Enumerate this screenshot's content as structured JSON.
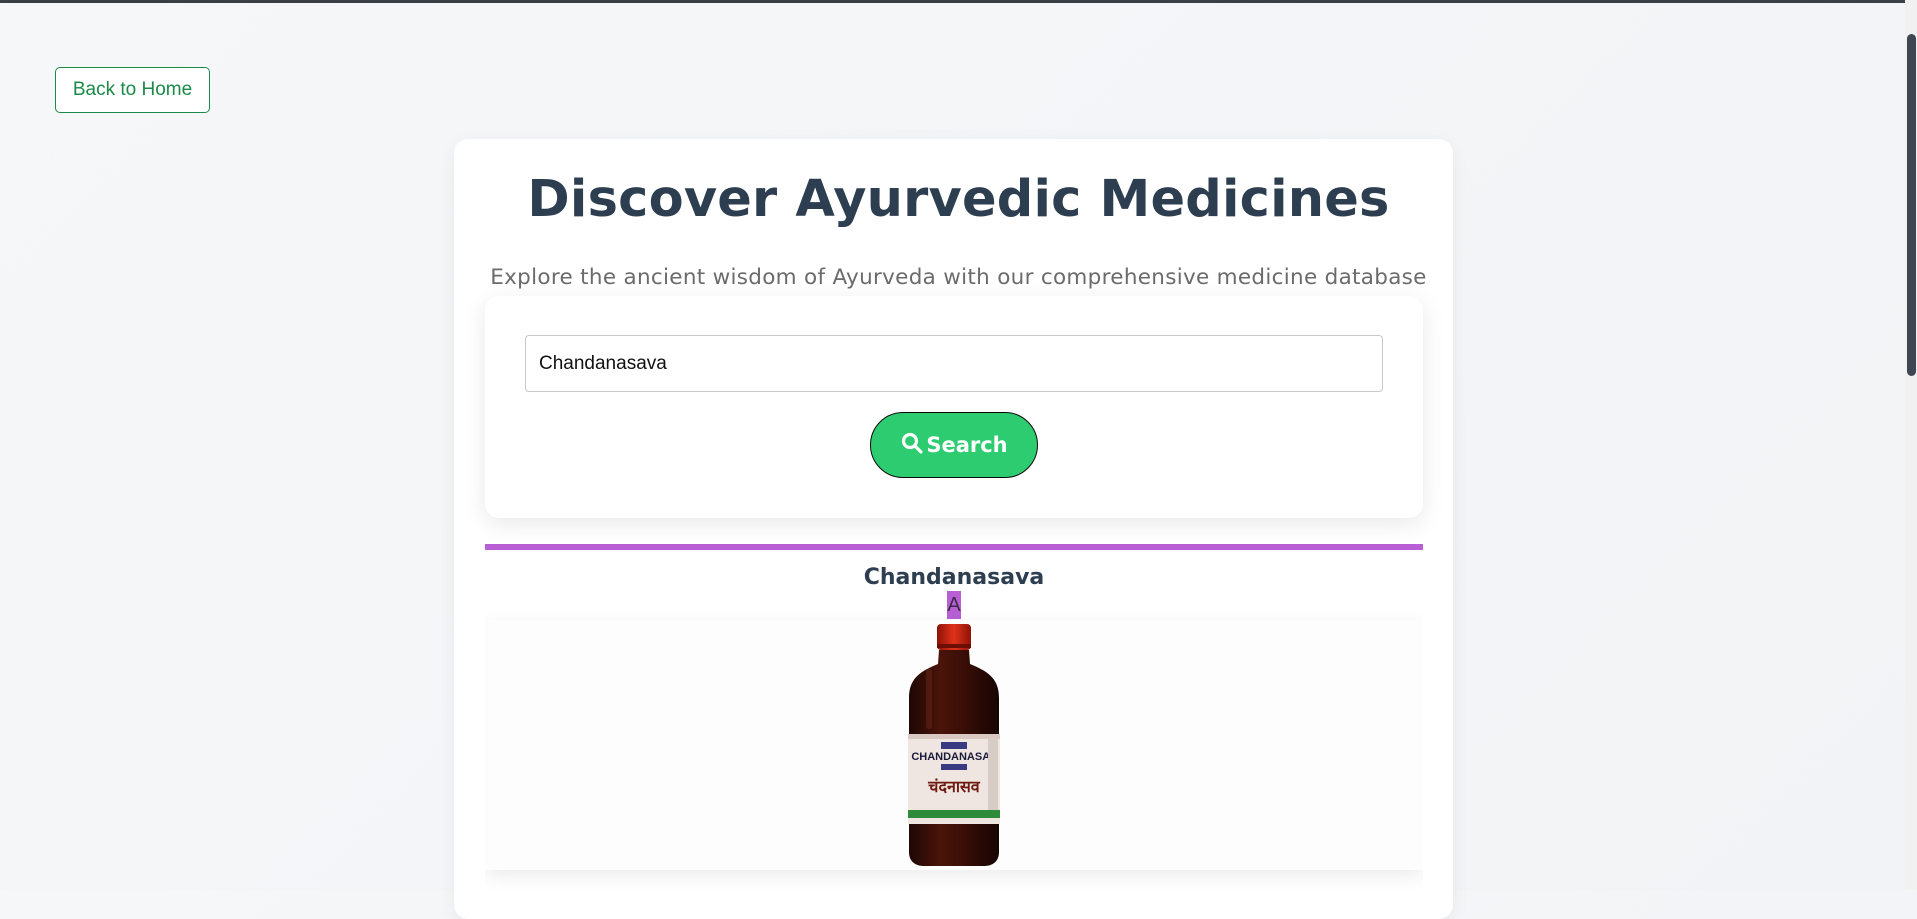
{
  "nav": {
    "back_label": "Back to Home"
  },
  "hero": {
    "title": "Discover Ayurvedic Medicines",
    "subtitle": "Explore the ancient wisdom of Ayurveda with our comprehensive medicine database"
  },
  "search": {
    "value": "Chandanasava",
    "button_label": "Search",
    "button_icon": "search-icon"
  },
  "result": {
    "name": "Chandanasava",
    "badge": "A",
    "label_latin": "CHANDANASAV",
    "label_devanagari": "चंदनासव"
  },
  "colors": {
    "accent_green": "#2ecc71",
    "link_green": "#1a8a49",
    "result_accent": "#b85fd6",
    "heading": "#2c3e50"
  }
}
